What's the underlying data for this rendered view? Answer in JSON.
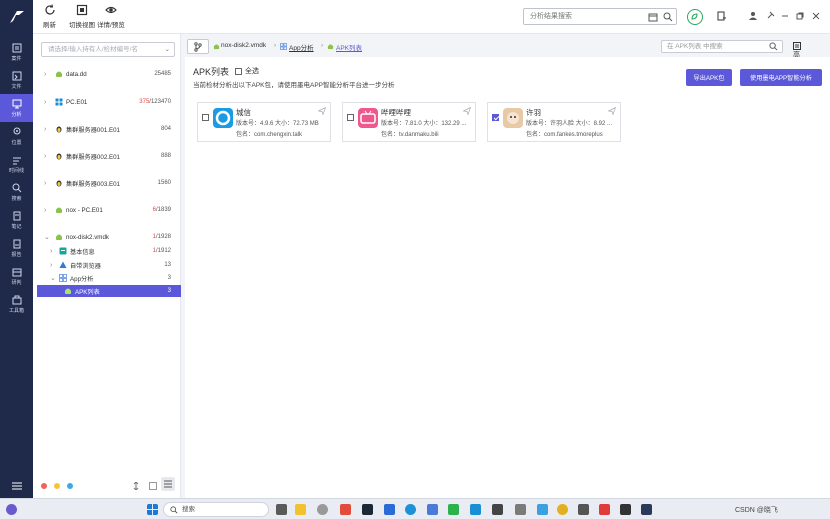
{
  "toolbar": {
    "refresh": "刷新",
    "switch_view": "切换视图",
    "detail_preview": "详情/预览",
    "search_placeholder": "分析结果搜索"
  },
  "nav": [
    {
      "label": "案件"
    },
    {
      "label": "文件"
    },
    {
      "label": "分析"
    },
    {
      "label": "位置"
    },
    {
      "label": "时间线"
    },
    {
      "label": "搜索"
    },
    {
      "label": "笔记"
    },
    {
      "label": "报告"
    },
    {
      "label": "研判"
    },
    {
      "label": "工具箱"
    }
  ],
  "tree": {
    "search_placeholder": "请选择/输入持有人/检材编号/名",
    "items": [
      {
        "label": "data.dd",
        "count": "25485",
        "red": ""
      },
      {
        "label": "PC.E01",
        "count": "/123470",
        "red": "375"
      },
      {
        "label": "集群服务器001.E01",
        "count": "804",
        "red": ""
      },
      {
        "label": "集群服务器002.E01",
        "count": "888",
        "red": ""
      },
      {
        "label": "集群服务器003.E01",
        "count": "1560",
        "red": ""
      },
      {
        "label": "nox - PC.E01",
        "count": "/1839",
        "red": "6"
      },
      {
        "label": "nox-disk2.vmdk",
        "count": "/1928",
        "red": "1"
      },
      {
        "label": "基本信息",
        "count": "/1912",
        "red": "1"
      },
      {
        "label": "自带浏览器",
        "count": "13",
        "red": ""
      },
      {
        "label": "App分析",
        "count": "3",
        "red": ""
      },
      {
        "label": "APK列表",
        "count": "3",
        "red": ""
      }
    ]
  },
  "breadcrumb": {
    "disk": "nox-disk2.vmdk",
    "app": "App分析",
    "current": "APK列表",
    "search_placeholder": "在 APK列表 中搜索",
    "advanced": "高级"
  },
  "apk": {
    "title": "APK列表",
    "select_all": "全选",
    "hint": "当前检材分析出以下APK包，请使用墨电APP智能分析平台进一步分析",
    "export_btn": "导出APK包",
    "analyze_btn": "使用墨电APP智能分析",
    "cards": [
      {
        "name": "城信",
        "ver": "版本号：4.9.6   大小：72.73 MB",
        "pkg": "包名：com.chengxin.talk",
        "checked": false,
        "color": "#1a9be6"
      },
      {
        "name": "哔哩哔哩",
        "ver": "版本号：7.81.0   大小：132.29 ...",
        "pkg": "包名：tv.danmaku.bili",
        "checked": false,
        "color": "#f0578d"
      },
      {
        "name": "许羽",
        "ver": "版本号：许羽人脸   大小：8.92 ...",
        "pkg": "包名：com.fankes.tmoreplus",
        "checked": true,
        "color": "#e8c9a5"
      }
    ]
  },
  "taskbar": {
    "search": "搜索",
    "tray_text": "CSDN @晓飞"
  },
  "colors": {
    "accent": "#5b59d9",
    "rail": "#1f2a4a"
  }
}
